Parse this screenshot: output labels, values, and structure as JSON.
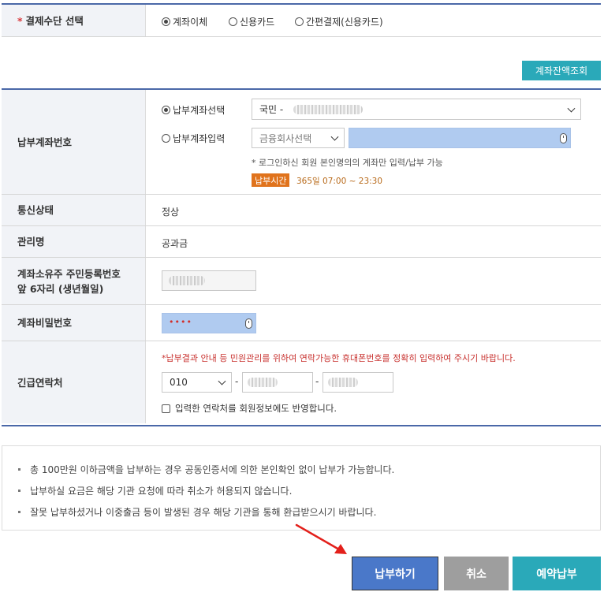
{
  "payment_method": {
    "label": "결제수단 선택",
    "required_mark": "*",
    "options": [
      "계좌이체",
      "신용카드",
      "간편결제(신용카드)"
    ],
    "selected": "계좌이체"
  },
  "balance_button": "계좌잔액조회",
  "account": {
    "label": "납부계좌번호",
    "option_select": "납부계좌선택",
    "option_input": "납부계좌입력",
    "bank_value": "국민 -",
    "institution_placeholder": "금융회사선택",
    "notice": "* 로그인하신 회원 본인명의의 계좌만 입력/납부 가능",
    "time_badge": "납부시간",
    "time_text": "365일 07:00 ~ 23:30"
  },
  "comm_status": {
    "label": "통신상태",
    "value": "정상"
  },
  "manage_name": {
    "label": "관리명",
    "value": "공과금"
  },
  "id_number": {
    "label_line1": "계좌소유주 주민등록번호",
    "label_line2": "앞 6자리 (생년월일)"
  },
  "password": {
    "label": "계좌비밀번호",
    "value": "••••"
  },
  "emergency": {
    "label": "긴급연락처",
    "notice": "*납부결과 안내 등 민원관리를 위하여 연락가능한 휴대폰번호를 정확히 입력하여 주시기 바랍니다.",
    "prefix": "010",
    "dash": "-",
    "checkbox_label": "입력한 연락처를 회원정보에도 반영합니다."
  },
  "notes": [
    "총 100만원 이하금액을 납부하는 경우 공동인증서에 의한 본인확인 없이 납부가 가능합니다.",
    "납부하실 요금은 해당 기관 요청에 따라 취소가 허용되지 않습니다.",
    "잘못 납부하셨거나 이중출금 등이 발생된 경우 해당 기관을 통해 환급받으시기 바랍니다."
  ],
  "buttons": {
    "pay": "납부하기",
    "cancel": "취소",
    "reserve": "예약납부"
  },
  "colors": {
    "accent": "#2aa9b9",
    "pay": "#4a78c9",
    "cancel": "#9e9e9e",
    "badge": "#e0731c",
    "notice_red": "#c8322f"
  }
}
